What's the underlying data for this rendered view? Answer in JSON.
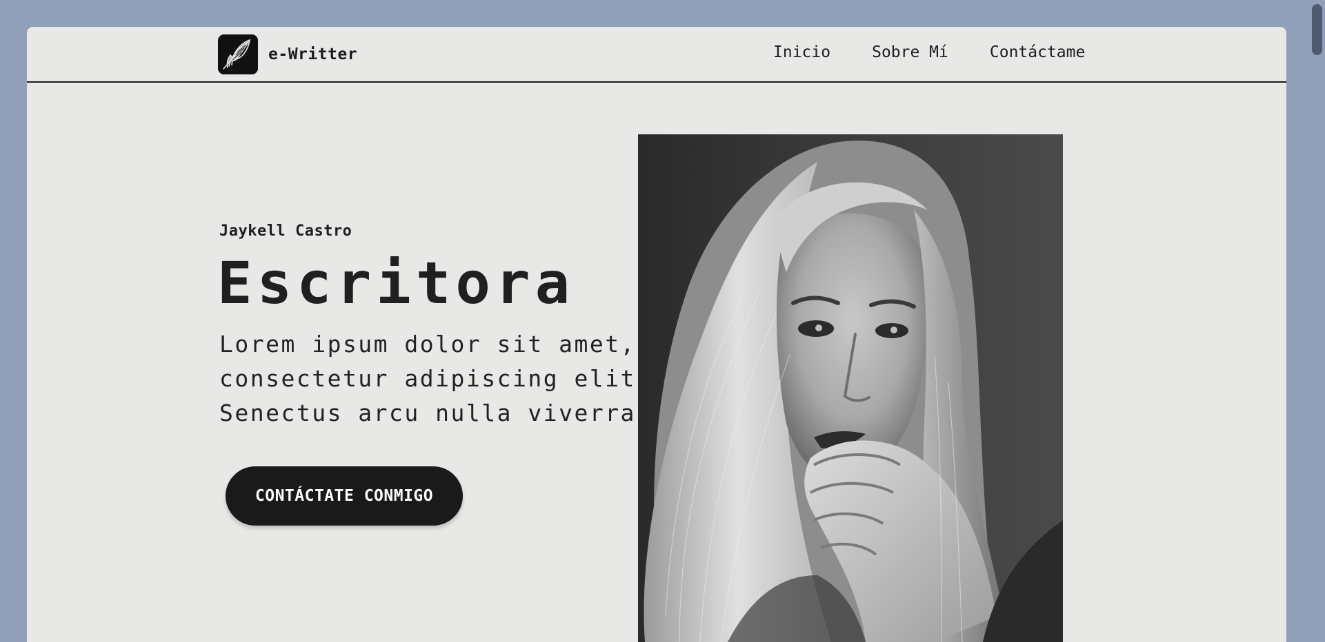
{
  "brand": {
    "name": "e-Writter",
    "logo_icon": "feather-quill-icon"
  },
  "nav": {
    "links": [
      {
        "label": "Inicio"
      },
      {
        "label": "Sobre Mí"
      },
      {
        "label": "Contáctame"
      }
    ]
  },
  "hero": {
    "author": "Jaykell Castro",
    "title": "Escritora",
    "text_lines": [
      "Lorem ipsum dolor sit amet,",
      "consectetur adipiscing elit.",
      "Senectus arcu nulla viverra"
    ],
    "cta_label": "CONTÁCTATE CONMIGO"
  },
  "portrait": {
    "subject": "black-and-white portrait of a woman with long light hair"
  },
  "colors": {
    "page_background": "#919fb8",
    "card_background": "#e8e9e6",
    "text": "#1c1c1c",
    "button_background": "#1a1a1a",
    "button_text": "#ffffff",
    "scrollbar_thumb": "#4f5a6e"
  }
}
